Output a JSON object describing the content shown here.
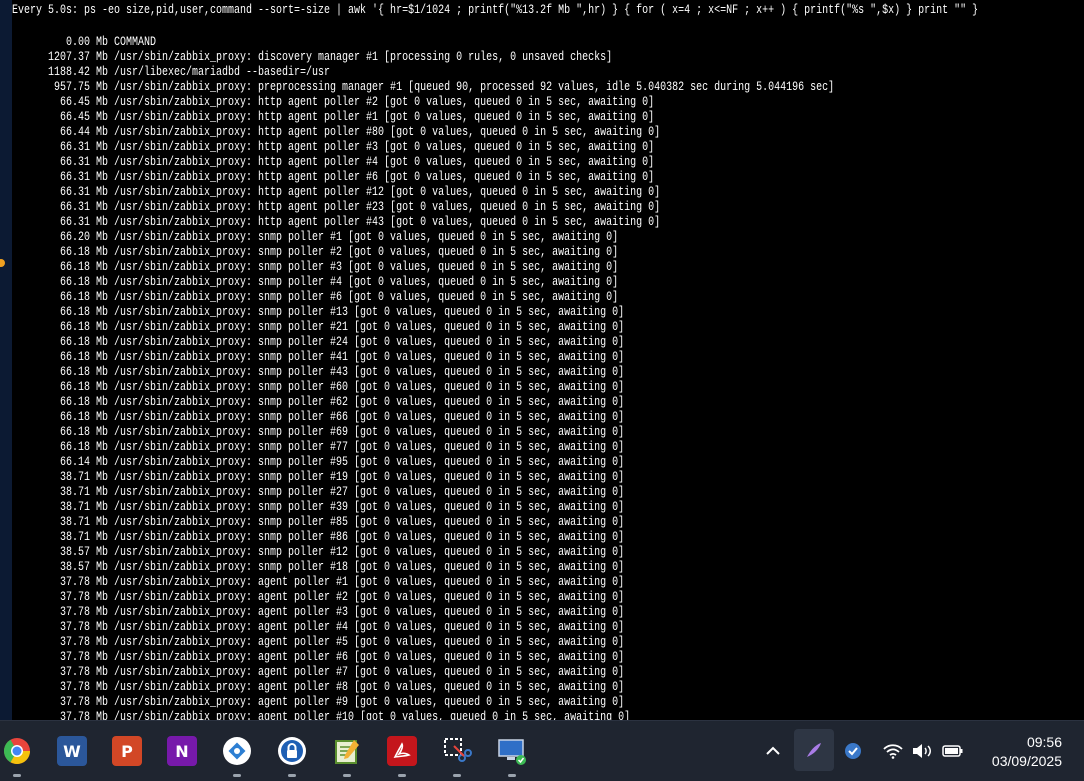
{
  "terminal": {
    "header": "Every 5.0s: ps -eo size,pid,user,command --sort=-size | awk '{ hr=$1/1024 ; printf(\"%13.2f Mb \",hr) } { for ( x=4 ; x<=NF ; x++ ) { printf(\"%s \",$x) } print \"\" }",
    "lines": [
      "         0.00 Mb COMMAND",
      "      1207.37 Mb /usr/sbin/zabbix_proxy: discovery manager #1 [processing 0 rules, 0 unsaved checks]",
      "      1188.42 Mb /usr/libexec/mariadbd --basedir=/usr",
      "       957.75 Mb /usr/sbin/zabbix_proxy: preprocessing manager #1 [queued 90, processed 92 values, idle 5.040382 sec during 5.044196 sec]",
      "        66.45 Mb /usr/sbin/zabbix_proxy: http agent poller #2 [got 0 values, queued 0 in 5 sec, awaiting 0]",
      "        66.45 Mb /usr/sbin/zabbix_proxy: http agent poller #1 [got 0 values, queued 0 in 5 sec, awaiting 0]",
      "        66.44 Mb /usr/sbin/zabbix_proxy: http agent poller #80 [got 0 values, queued 0 in 5 sec, awaiting 0]",
      "        66.31 Mb /usr/sbin/zabbix_proxy: http agent poller #3 [got 0 values, queued 0 in 5 sec, awaiting 0]",
      "        66.31 Mb /usr/sbin/zabbix_proxy: http agent poller #4 [got 0 values, queued 0 in 5 sec, awaiting 0]",
      "        66.31 Mb /usr/sbin/zabbix_proxy: http agent poller #6 [got 0 values, queued 0 in 5 sec, awaiting 0]",
      "        66.31 Mb /usr/sbin/zabbix_proxy: http agent poller #12 [got 0 values, queued 0 in 5 sec, awaiting 0]",
      "        66.31 Mb /usr/sbin/zabbix_proxy: http agent poller #23 [got 0 values, queued 0 in 5 sec, awaiting 0]",
      "        66.31 Mb /usr/sbin/zabbix_proxy: http agent poller #43 [got 0 values, queued 0 in 5 sec, awaiting 0]",
      "        66.20 Mb /usr/sbin/zabbix_proxy: snmp poller #1 [got 0 values, queued 0 in 5 sec, awaiting 0]",
      "        66.18 Mb /usr/sbin/zabbix_proxy: snmp poller #2 [got 0 values, queued 0 in 5 sec, awaiting 0]",
      "        66.18 Mb /usr/sbin/zabbix_proxy: snmp poller #3 [got 0 values, queued 0 in 5 sec, awaiting 0]",
      "        66.18 Mb /usr/sbin/zabbix_proxy: snmp poller #4 [got 0 values, queued 0 in 5 sec, awaiting 0]",
      "        66.18 Mb /usr/sbin/zabbix_proxy: snmp poller #6 [got 0 values, queued 0 in 5 sec, awaiting 0]",
      "        66.18 Mb /usr/sbin/zabbix_proxy: snmp poller #13 [got 0 values, queued 0 in 5 sec, awaiting 0]",
      "        66.18 Mb /usr/sbin/zabbix_proxy: snmp poller #21 [got 0 values, queued 0 in 5 sec, awaiting 0]",
      "        66.18 Mb /usr/sbin/zabbix_proxy: snmp poller #24 [got 0 values, queued 0 in 5 sec, awaiting 0]",
      "        66.18 Mb /usr/sbin/zabbix_proxy: snmp poller #41 [got 0 values, queued 0 in 5 sec, awaiting 0]",
      "        66.18 Mb /usr/sbin/zabbix_proxy: snmp poller #43 [got 0 values, queued 0 in 5 sec, awaiting 0]",
      "        66.18 Mb /usr/sbin/zabbix_proxy: snmp poller #60 [got 0 values, queued 0 in 5 sec, awaiting 0]",
      "        66.18 Mb /usr/sbin/zabbix_proxy: snmp poller #62 [got 0 values, queued 0 in 5 sec, awaiting 0]",
      "        66.18 Mb /usr/sbin/zabbix_proxy: snmp poller #66 [got 0 values, queued 0 in 5 sec, awaiting 0]",
      "        66.18 Mb /usr/sbin/zabbix_proxy: snmp poller #69 [got 0 values, queued 0 in 5 sec, awaiting 0]",
      "        66.18 Mb /usr/sbin/zabbix_proxy: snmp poller #77 [got 0 values, queued 0 in 5 sec, awaiting 0]",
      "        66.14 Mb /usr/sbin/zabbix_proxy: snmp poller #95 [got 0 values, queued 0 in 5 sec, awaiting 0]",
      "        38.71 Mb /usr/sbin/zabbix_proxy: snmp poller #19 [got 0 values, queued 0 in 5 sec, awaiting 0]",
      "        38.71 Mb /usr/sbin/zabbix_proxy: snmp poller #27 [got 0 values, queued 0 in 5 sec, awaiting 0]",
      "        38.71 Mb /usr/sbin/zabbix_proxy: snmp poller #39 [got 0 values, queued 0 in 5 sec, awaiting 0]",
      "        38.71 Mb /usr/sbin/zabbix_proxy: snmp poller #85 [got 0 values, queued 0 in 5 sec, awaiting 0]",
      "        38.71 Mb /usr/sbin/zabbix_proxy: snmp poller #86 [got 0 values, queued 0 in 5 sec, awaiting 0]",
      "        38.57 Mb /usr/sbin/zabbix_proxy: snmp poller #12 [got 0 values, queued 0 in 5 sec, awaiting 0]",
      "        38.57 Mb /usr/sbin/zabbix_proxy: snmp poller #18 [got 0 values, queued 0 in 5 sec, awaiting 0]",
      "        37.78 Mb /usr/sbin/zabbix_proxy: agent poller #1 [got 0 values, queued 0 in 5 sec, awaiting 0]",
      "        37.78 Mb /usr/sbin/zabbix_proxy: agent poller #2 [got 0 values, queued 0 in 5 sec, awaiting 0]",
      "        37.78 Mb /usr/sbin/zabbix_proxy: agent poller #3 [got 0 values, queued 0 in 5 sec, awaiting 0]",
      "        37.78 Mb /usr/sbin/zabbix_proxy: agent poller #4 [got 0 values, queued 0 in 5 sec, awaiting 0]",
      "        37.78 Mb /usr/sbin/zabbix_proxy: agent poller #5 [got 0 values, queued 0 in 5 sec, awaiting 0]",
      "        37.78 Mb /usr/sbin/zabbix_proxy: agent poller #6 [got 0 values, queued 0 in 5 sec, awaiting 0]",
      "        37.78 Mb /usr/sbin/zabbix_proxy: agent poller #7 [got 0 values, queued 0 in 5 sec, awaiting 0]",
      "        37.78 Mb /usr/sbin/zabbix_proxy: agent poller #8 [got 0 values, queued 0 in 5 sec, awaiting 0]",
      "        37.78 Mb /usr/sbin/zabbix_proxy: agent poller #9 [got 0 values, queued 0 in 5 sec, awaiting 0]",
      "        37.78 Mb /usr/sbin/zabbix_proxy: agent poller #10 [got 0 values, queued 0 in 5 sec, awaiting 0]"
    ]
  },
  "taskbar": {
    "apps": [
      {
        "name": "chrome-icon",
        "glyph": "",
        "color": "#e8453c"
      },
      {
        "name": "word-icon",
        "glyph": "W",
        "color": "#2b579a"
      },
      {
        "name": "powerpoint-icon",
        "glyph": "P",
        "color": "#d24726"
      },
      {
        "name": "onenote-icon",
        "glyph": "N",
        "color": "#7719aa"
      },
      {
        "name": "network-app-icon",
        "glyph": "",
        "color": "#2d7fd3"
      },
      {
        "name": "vpn-lock-icon",
        "glyph": "",
        "color": "#1e5fb4"
      },
      {
        "name": "notepad-icon",
        "glyph": "",
        "color": "#5a8f2e"
      },
      {
        "name": "pdf-reader-icon",
        "glyph": "",
        "color": "#c4161c"
      },
      {
        "name": "snipping-tool-icon",
        "glyph": "",
        "color": "#3a78c8"
      },
      {
        "name": "remote-desktop-icon",
        "glyph": "",
        "color": "#2f6fc7"
      }
    ],
    "clock": {
      "time": "09:56",
      "date": "03/09/2025"
    }
  }
}
